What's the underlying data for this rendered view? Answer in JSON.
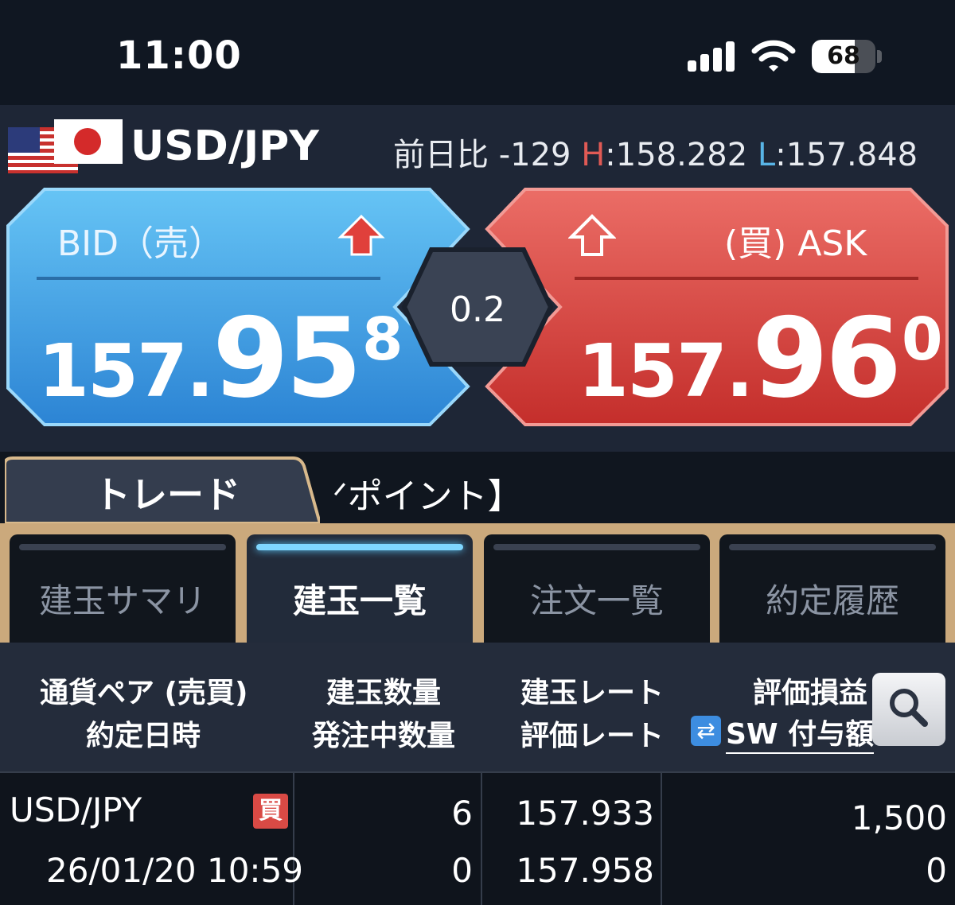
{
  "status_bar": {
    "time": "11:00",
    "battery": "68",
    "battery_level": 0.68
  },
  "quote": {
    "pair": "USD/JPY",
    "change_label": "前日比",
    "change_value": "-129",
    "high_label": "H",
    "high_value": "158.282",
    "low_label": "L",
    "low_value": "157.848",
    "bid": {
      "label": "BID（売）",
      "main": "157.",
      "big": "95",
      "sup": "8",
      "color": "#4aa6e8"
    },
    "ask": {
      "label": "(買) ASK",
      "main": "157.",
      "big": "96",
      "sup": "0",
      "color": "#d9443e"
    },
    "spread": "0.2"
  },
  "tabs": {
    "trade": "トレード",
    "point": "ポイント】"
  },
  "subtabs": [
    {
      "label": "建玉サマリ",
      "active": false
    },
    {
      "label": "建玉一覧",
      "active": true
    },
    {
      "label": "注文一覧",
      "active": false
    },
    {
      "label": "約定履歴",
      "active": false
    }
  ],
  "table": {
    "headers": {
      "pair": "通貨ペア (売買)",
      "date": "約定日時",
      "qty": "建玉数量",
      "pending_qty": "発注中数量",
      "rate": "建玉レート",
      "eval_rate": "評価レート",
      "pnl": "評価損益",
      "sw_icon": "⇄",
      "sw": "SW 付与額"
    },
    "rows": [
      {
        "pair": "USD/JPY",
        "side": "買",
        "date": "26/01/20 10:59",
        "qty": "6",
        "pending_qty": "0",
        "rate": "157.933",
        "eval_rate": "157.958",
        "pnl": "1,500",
        "sw": "0"
      }
    ]
  }
}
